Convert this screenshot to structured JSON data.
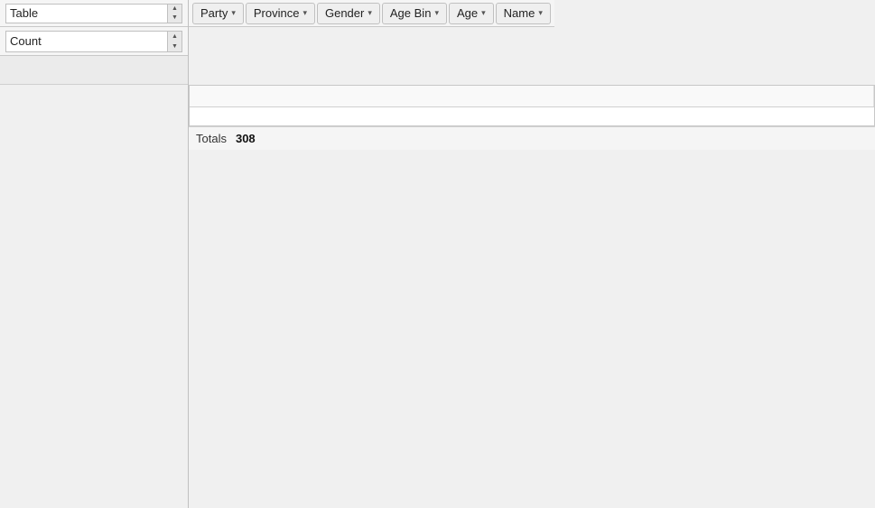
{
  "left_panel": {
    "table_select": {
      "label": "Table",
      "value": "Table"
    },
    "count_select": {
      "label": "Count",
      "value": "Count"
    }
  },
  "filter_bar": {
    "buttons": [
      {
        "label": "Party",
        "id": "party"
      },
      {
        "label": "Province",
        "id": "province"
      },
      {
        "label": "Gender",
        "id": "gender"
      },
      {
        "label": "Age Bin",
        "id": "age-bin"
      },
      {
        "label": "Age",
        "id": "age"
      },
      {
        "label": "Name",
        "id": "name"
      }
    ]
  },
  "totals": {
    "label": "Totals",
    "value": "308"
  }
}
